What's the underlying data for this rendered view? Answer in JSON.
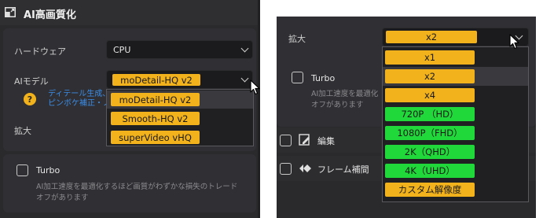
{
  "left": {
    "title": "AI高画質化",
    "hardware": {
      "label": "ハードウェア",
      "value": "CPU"
    },
    "ai_model": {
      "label": "AIモデル",
      "selected": "moDetail-HQ  v2",
      "options": [
        "moDetail-HQ  v2",
        "Smooth-HQ  v2",
        "superVideo vHQ"
      ]
    },
    "help_text": [
      "ディテール生成、",
      "ピンボケ補正・ノ"
    ],
    "scale_label": "拡大",
    "turbo": {
      "label": "Turbo",
      "desc_lines": [
        "AI加工速度を最適化するほど画質がわずかな損失のトレード",
        "オフがあります"
      ]
    }
  },
  "right": {
    "scale": {
      "label": "拡大",
      "selected": "x2",
      "options": [
        "x1",
        "x2",
        "x4",
        "720P （HD）",
        "1080P（FHD）",
        "2K（QHD）",
        "4K（UHD）",
        "カスタム解像度"
      ]
    },
    "turbo": {
      "label": "Turbo",
      "desc_lines": [
        "AI加工速度を最適化",
        "オフがあります"
      ]
    },
    "edit_label": "編集",
    "frame_interp_label": "フレーム補間"
  },
  "colors": {
    "accent_yellow": "#f2b21c",
    "accent_green": "#20d83a",
    "link_blue": "#3a8de8"
  }
}
